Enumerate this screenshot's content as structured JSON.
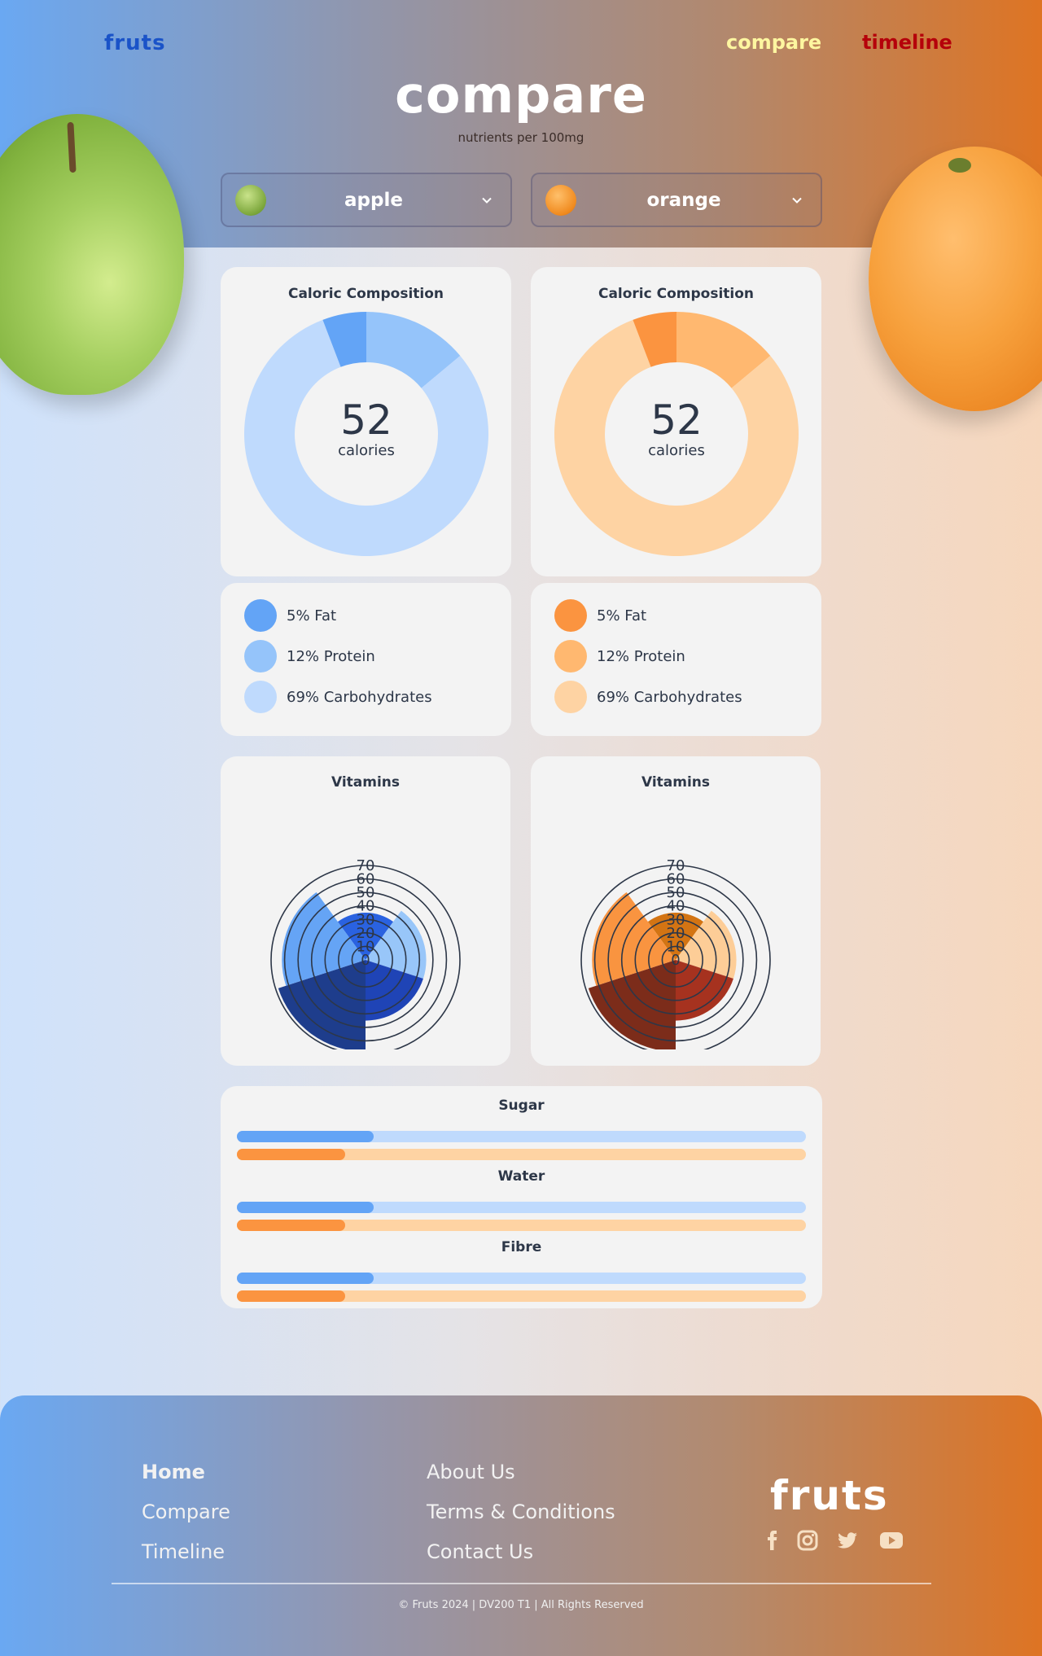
{
  "header": {
    "logo": "fruts",
    "nav": {
      "compare": "compare",
      "timeline": "timeline"
    },
    "title": "compare",
    "subtitle": "nutrients per 100mg"
  },
  "selectors": [
    {
      "name": "apple",
      "icon": "apple-icon"
    },
    {
      "name": "orange",
      "icon": "orange-icon"
    }
  ],
  "cards": [
    {
      "fruit": "apple",
      "caloric_title": "Caloric Composition",
      "calories": "52",
      "calories_label": "calories",
      "legend": [
        "5% Fat",
        "12% Protein",
        "69% Carbohydrates"
      ],
      "colors": [
        "#63a4f6",
        "#95c4fa",
        "#bfdafd"
      ],
      "vitamins_title": "Vitamins",
      "polar_colors": [
        "#2a62e0",
        "#98c6f9",
        "#1f44b6",
        "#1e3d8c",
        "#65a4f5"
      ]
    },
    {
      "fruit": "orange",
      "caloric_title": "Caloric Composition",
      "calories": "52",
      "calories_label": "calories",
      "legend": [
        "5% Fat",
        "12% Protein",
        "69% Carbohydrates"
      ],
      "colors": [
        "#fb9440",
        "#ffb870",
        "#fed3a3"
      ],
      "vitamins_title": "Vitamins",
      "polar_colors": [
        "#d37413",
        "#fdcd97",
        "#a6321f",
        "#7c2c1a",
        "#f99440"
      ]
    }
  ],
  "chart_data": [
    {
      "type": "pie",
      "title": "Caloric Composition",
      "center_value": "52",
      "center_label": "calories",
      "categories": [
        "Fat",
        "Protein",
        "Carbohydrates"
      ],
      "values": [
        5,
        12,
        69
      ]
    },
    {
      "type": "pie",
      "title": "Caloric Composition",
      "center_value": "52",
      "center_label": "calories",
      "categories": [
        "Fat",
        "Protein",
        "Carbohydrates"
      ],
      "values": [
        5,
        12,
        69
      ]
    },
    {
      "type": "polar-area",
      "title": "Vitamins",
      "rmax": 70,
      "ticks": [
        "0",
        "10",
        "20",
        "30",
        "40",
        "50",
        "60",
        "70"
      ],
      "values": [
        35,
        45,
        45,
        68,
        62
      ]
    },
    {
      "type": "polar-area",
      "title": "Vitamins",
      "rmax": 70,
      "ticks": [
        "0",
        "10",
        "20",
        "30",
        "40",
        "50",
        "60",
        "70"
      ],
      "values": [
        35,
        45,
        45,
        68,
        62
      ]
    },
    {
      "type": "bar",
      "categories": [
        "Sugar",
        "Water",
        "Fibre"
      ],
      "series": [
        {
          "values": [
            24,
            24,
            24
          ]
        },
        {
          "values": [
            19,
            19,
            19
          ]
        }
      ],
      "ylim": [
        0,
        100
      ]
    }
  ],
  "bars": {
    "labels": [
      "Sugar",
      "Water",
      "Fibre"
    ],
    "apple_color": "#63a4f6",
    "apple_track": "#bfdafd",
    "orange_color": "#fb9440",
    "orange_track": "#fed3a3"
  },
  "footer": {
    "links_col1": [
      "Home",
      "Compare",
      "Timeline"
    ],
    "links_col2": [
      "About Us",
      "Terms & Conditions",
      "Contact Us"
    ],
    "logo": "fruts",
    "social": [
      "facebook-icon",
      "instagram-icon",
      "twitter-icon",
      "youtube-icon"
    ],
    "copyright": "© Fruts 2024 | DV200 T1 | All Rights Reserved"
  }
}
